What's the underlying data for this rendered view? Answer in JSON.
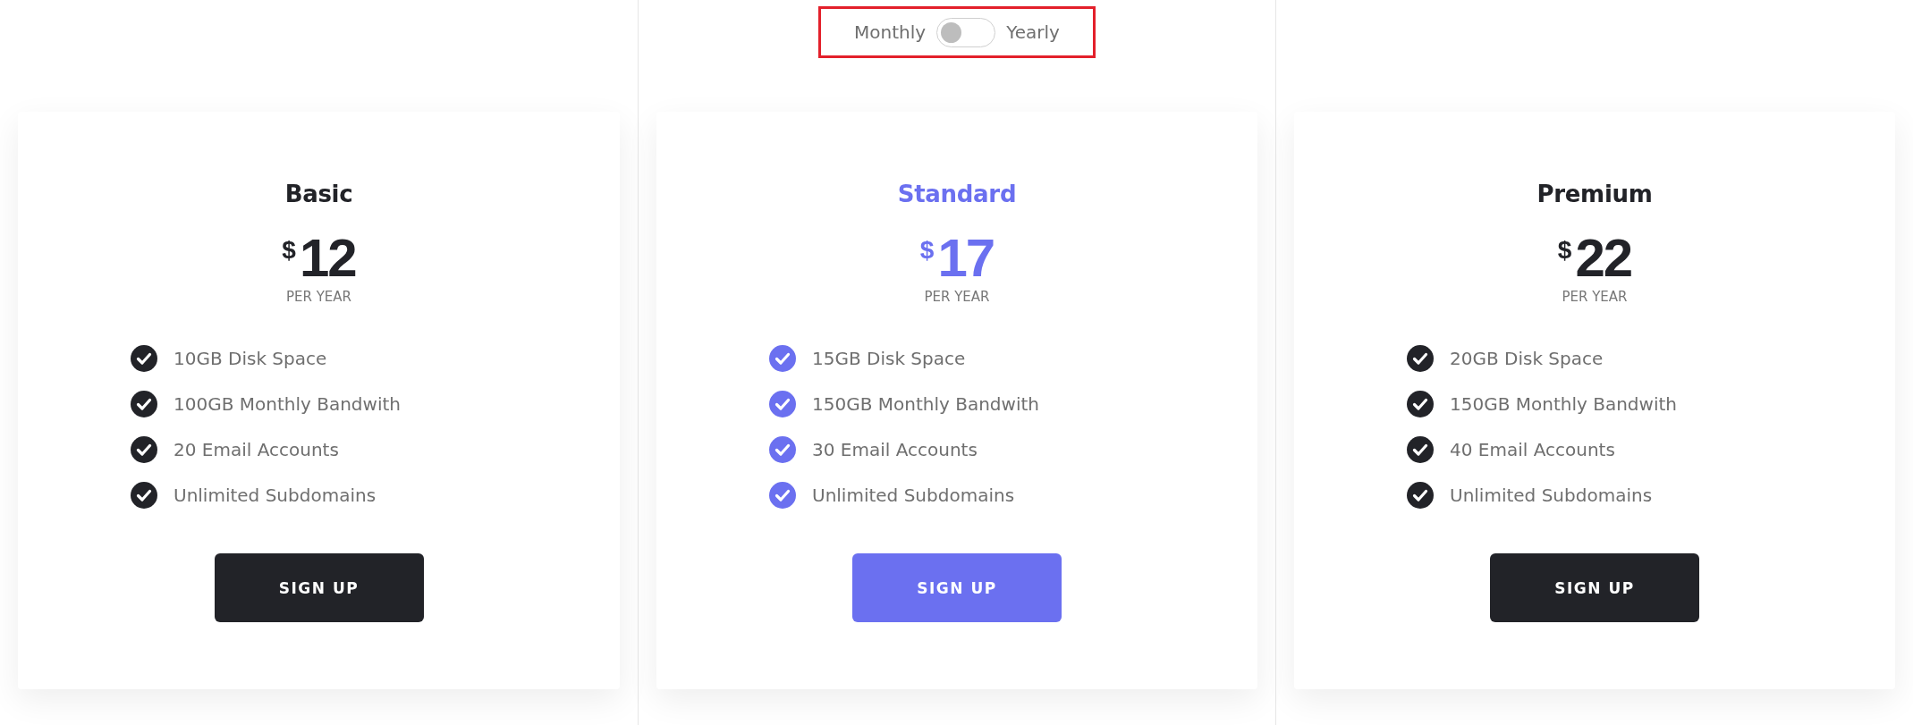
{
  "billing_toggle": {
    "highlighted": true,
    "left_label": "Monthly",
    "right_label": "Yearly",
    "on": false
  },
  "plans": [
    {
      "name": "Basic",
      "featured": false,
      "currency": "$",
      "price": "12",
      "period": "PER YEAR",
      "features": [
        "10GB Disk Space",
        "100GB Monthly Bandwith",
        "20 Email Accounts",
        "Unlimited Subdomains"
      ],
      "button": "SIGN UP"
    },
    {
      "name": "Standard",
      "featured": true,
      "currency": "$",
      "price": "17",
      "period": "PER YEAR",
      "features": [
        "15GB Disk Space",
        "150GB Monthly Bandwith",
        "30 Email Accounts",
        "Unlimited Subdomains"
      ],
      "button": "SIGN UP"
    },
    {
      "name": "Premium",
      "featured": false,
      "currency": "$",
      "price": "22",
      "period": "PER YEAR",
      "features": [
        "20GB Disk Space",
        "150GB Monthly Bandwith",
        "40 Email Accounts",
        "Unlimited Subdomains"
      ],
      "button": "SIGN UP"
    }
  ]
}
